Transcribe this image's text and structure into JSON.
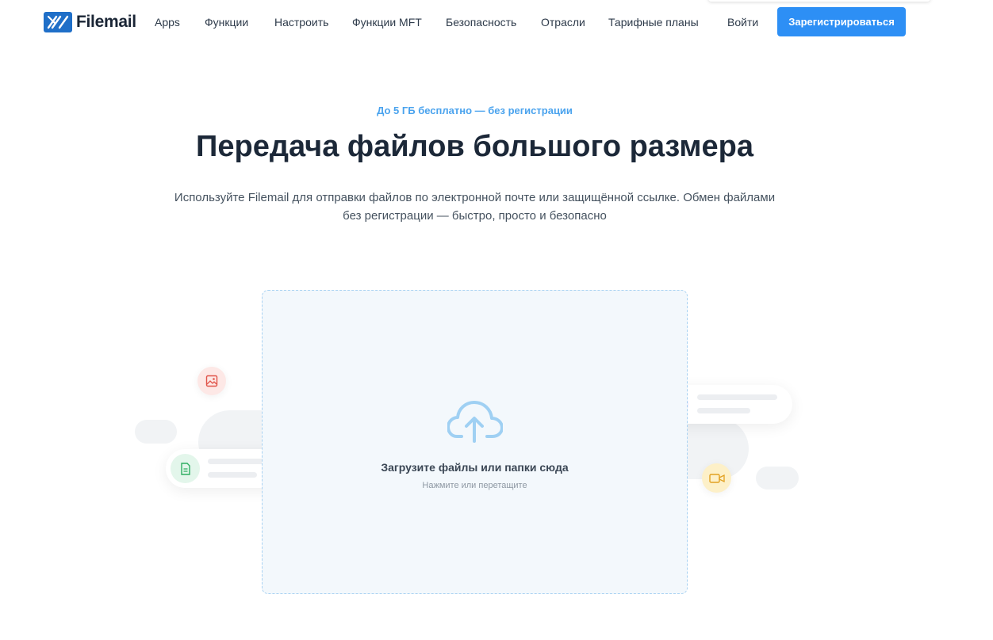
{
  "header": {
    "logo_text": "Filemail",
    "nav": [
      "Apps",
      "Функции",
      "Настроить",
      "Функции MFT",
      "Безопасность",
      "Отрасли",
      "Тарифные планы"
    ],
    "login_label": "Войти",
    "register_label": "Зарегистрироваться"
  },
  "hero": {
    "eyebrow": "До 5 ГБ бесплатно — без регистрации",
    "title": "Передача файлов большого размера",
    "subtitle_line1": "Используйте Filemail для отправки файлов по электронной почте или защищённой ссылке. Обмен файлами",
    "subtitle_line2": "без регистрации — быстро, просто и безопасно"
  },
  "upload": {
    "title": "Загрузите файлы или папки сюда",
    "hint": "Нажмите или перетащите",
    "icon": "cloud-upload-icon"
  },
  "decorations": {
    "icons": [
      "image-icon",
      "document-icon",
      "folder-icon",
      "video-icon"
    ]
  },
  "colors": {
    "accent": "#2d8ff5",
    "eyebrow": "#4aa3ee",
    "dropzone_bg": "#f3f8fc",
    "dropzone_border": "#a9d2f2"
  }
}
